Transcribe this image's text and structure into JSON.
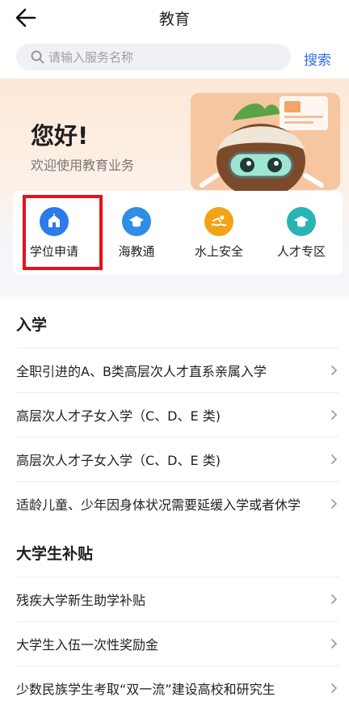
{
  "header": {
    "title": "教育"
  },
  "search": {
    "placeholder": "请输入服务名称",
    "button_label": "搜索"
  },
  "hero": {
    "greeting": "您好!",
    "subtitle": "欢迎使用教育业务"
  },
  "quick_services": [
    {
      "label": "学位申请",
      "icon": "school-building-icon",
      "color": "#2d7be8"
    },
    {
      "label": "海教通",
      "icon": "graduation-cap-icon",
      "color": "#2f8ee6"
    },
    {
      "label": "水上安全",
      "icon": "swimmer-icon",
      "color": "#f2a416"
    },
    {
      "label": "人才专区",
      "icon": "graduation-cap-icon",
      "color": "#2ab3b4"
    }
  ],
  "sections": [
    {
      "title": "入学",
      "items": [
        "全职引进的A、B类高层次人才直系亲属入学",
        "高层次人才子女入学（C、D、E 类)",
        "高层次人才子女入学（C、D、E 类)",
        "适龄儿童、少年因身体状况需要延缓入学或者休学"
      ]
    },
    {
      "title": "大学生补贴",
      "items": [
        "残疾大学新生助学补贴",
        "大学生入伍一次性奖励金",
        "少数民族学生考取“双一流”建设高校和研究生"
      ]
    }
  ],
  "colors": {
    "accent": "#2f6fe6",
    "highlight": "#e8111a"
  }
}
